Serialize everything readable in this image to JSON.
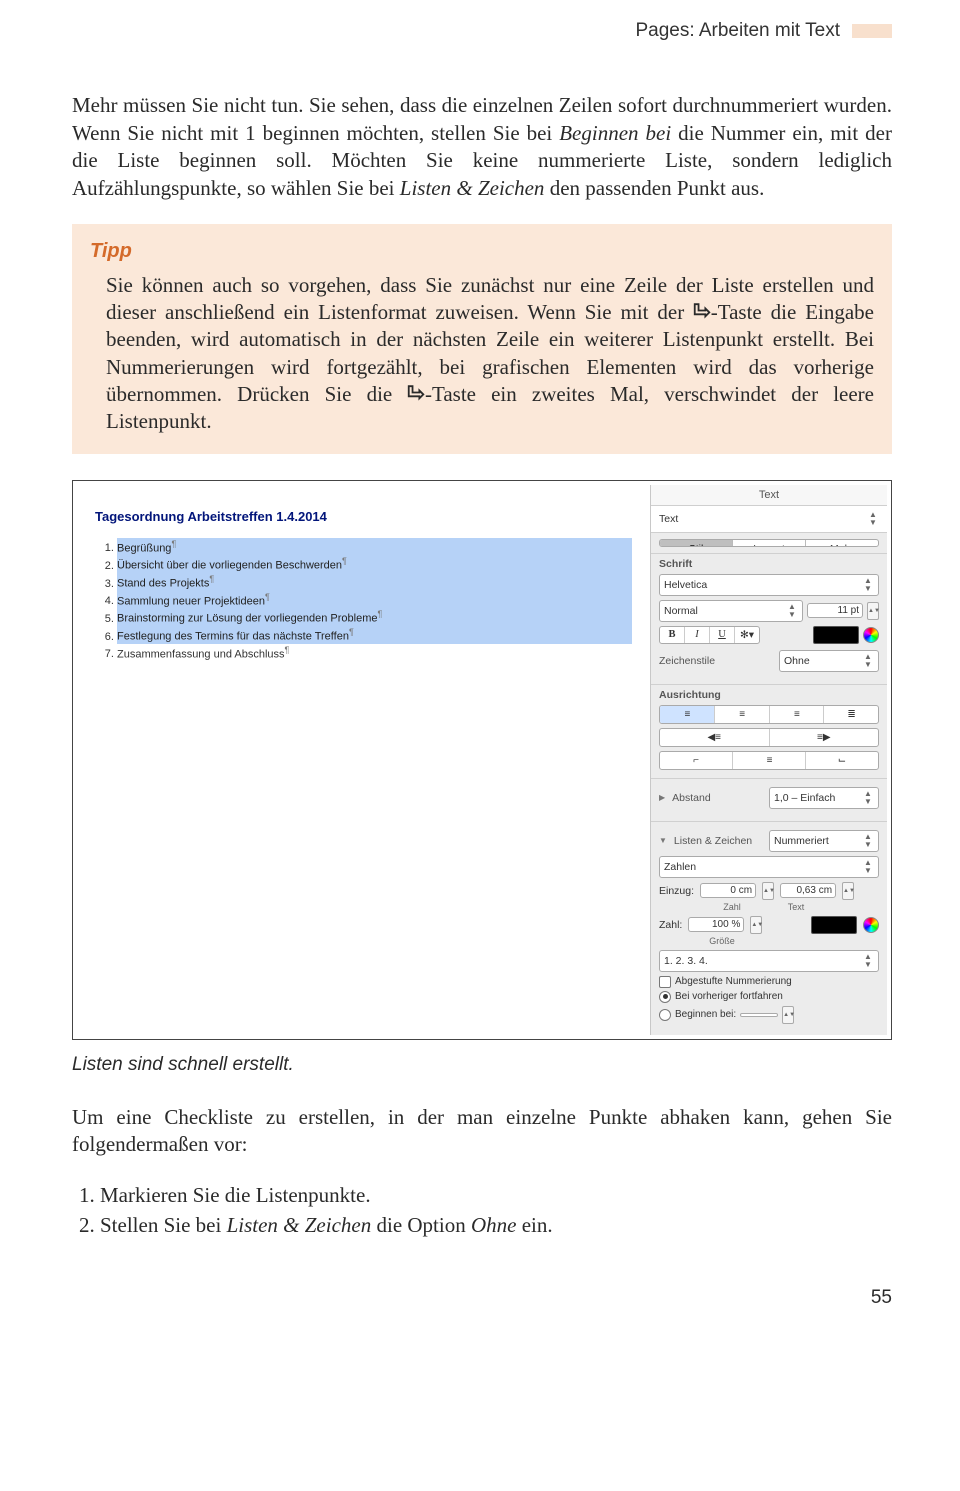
{
  "header": {
    "title": "Pages: Arbeiten mit Text"
  },
  "para1": "Mehr müssen Sie nicht tun. Sie sehen, dass die einzelnen Zeilen sofort durchnummeriert wurden. Wenn Sie nicht mit 1 beginnen möchten, stellen Sie bei ",
  "para1_i1": "Beginnen bei",
  "para1_mid": " die Nummer ein, mit der die Liste beginnen soll. Möchten Sie keine nummerierte Liste, sondern lediglich Aufzählungspunkte, so wählen Sie bei ",
  "para1_i2": "Listen & Zeichen",
  "para1_end": " den passenden Punkt aus.",
  "tip": {
    "label": "Tipp",
    "t1": "Sie können auch so vorgehen, dass Sie zunächst nur eine Zeile der Liste erstellen und dieser anschließend ein Listenformat zuweisen. Wenn Sie mit der ",
    "t2": "-Taste die Eingabe beenden, wird automatisch in der nächsten Zeile ein weiterer Listenpunkt erstellt. Bei Nummerierungen wird fortgezählt, bei grafischen Elementen wird das vorherige übernommen. Drücken Sie die ",
    "t3": "-Taste ein zweites Mal, verschwindet der leere Listenpunkt."
  },
  "document": {
    "title": "Tagesordnung Arbeitstreffen 1.4.2014",
    "items": [
      {
        "n": "1.",
        "t": "Begrüßung",
        "sel": true
      },
      {
        "n": "2.",
        "t": "Übersicht über die vorliegenden Beschwerden",
        "sel": true
      },
      {
        "n": "3.",
        "t": "Stand des Projekts",
        "sel": true
      },
      {
        "n": "4.",
        "t": "Sammlung neuer Projektideen",
        "sel": true
      },
      {
        "n": "5.",
        "t": "Brainstorming zur Lösung der vorliegenden Probleme",
        "sel": true
      },
      {
        "n": "6.",
        "t": "Festlegung des Termins für das nächste Treffen",
        "sel": true
      },
      {
        "n": "7.",
        "t": "Zusammenfassung und Abschluss",
        "sel": false
      }
    ]
  },
  "inspector": {
    "top": "Text",
    "pstyle": "Text",
    "tabs": {
      "stil": "Stil",
      "layout": "Layout",
      "mehr": "Mehr"
    },
    "schrift_label": "Schrift",
    "font": "Helvetica",
    "typeface": "Normal",
    "size": "11 pt",
    "b": "B",
    "i": "I",
    "u": "U",
    "gear": "✻",
    "zeichen_label": "Zeichenstile",
    "zeichen_value": "Ohne",
    "align_label": "Ausrichtung",
    "abstand_label": "Abstand",
    "abstand_value": "1,0 – Einfach",
    "listen_label": "Listen & Zeichen",
    "listen_value": "Nummeriert",
    "zahlen_label": "Zahlen",
    "einzug_label": "Einzug:",
    "einzug_zahl": "0 cm",
    "einzug_text": "0,63 cm",
    "zahl_sub": "Zahl",
    "text_sub": "Text",
    "zahl_label": "Zahl:",
    "zahl_value": "100 %",
    "größe_sub": "Größe",
    "format": "1. 2. 3. 4.",
    "check1": "Abgestufte Nummerierung",
    "opt1": "Bei vorheriger fortfahren",
    "opt2": "Beginnen bei:"
  },
  "caption": "Listen sind schnell erstellt.",
  "after": "Um eine Checkliste zu erstellen, in der man einzelne Punkte abhaken kann, gehen Sie folgendermaßen vor:",
  "steps": {
    "s1": "Markieren Sie die Listenpunkte.",
    "s2a": "Stellen Sie bei ",
    "s2i1": "Listen & Zeichen",
    "s2b": " die Option ",
    "s2i2": "Ohne",
    "s2c": " ein."
  },
  "pagenum": "55"
}
